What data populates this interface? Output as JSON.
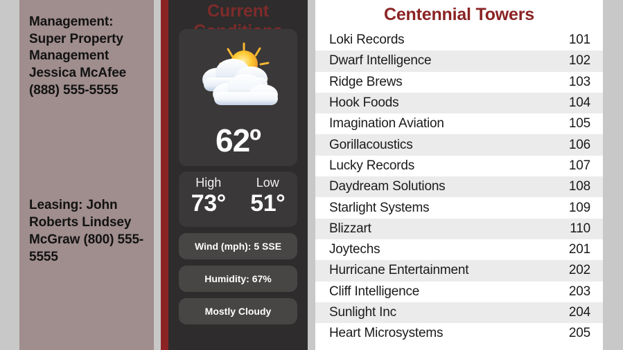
{
  "background_color": "#c8c8c8",
  "contact_panel": {
    "background_color": "#a08d8d",
    "management": "Management: Super Property Management Jessica McAfee (888) 555-5555",
    "leasing": "Leasing: John Roberts Lindsey McGraw (800) 555-5555"
  },
  "weather_panel": {
    "background_color": "#2e2c2c",
    "accent_bar_color": "#8b2324",
    "title": "Current Conditions",
    "title_color": "#7e2b2b",
    "icon": "partly-cloudy-sun-icon",
    "current_temp": "62º",
    "high_label": "High",
    "high_value": "73°",
    "low_label": "Low",
    "low_value": "51°",
    "wind": "Wind (mph): 5 SSE",
    "humidity": "Humidity: 67%",
    "condition": "Mostly Cloudy"
  },
  "directory_panel": {
    "title": "Centennial Towers",
    "title_color": "#8b2324",
    "rows": [
      {
        "name": "Loki Records",
        "suite": "101"
      },
      {
        "name": "Dwarf Intelligence",
        "suite": "102"
      },
      {
        "name": "Ridge Brews",
        "suite": "103"
      },
      {
        "name": "Hook Foods",
        "suite": "104"
      },
      {
        "name": "Imagination Aviation",
        "suite": "105"
      },
      {
        "name": "Gorillacoustics",
        "suite": "106"
      },
      {
        "name": "Lucky Records",
        "suite": "107"
      },
      {
        "name": "Daydream Solutions",
        "suite": "108"
      },
      {
        "name": "Starlight Systems",
        "suite": "109"
      },
      {
        "name": "Blizzart",
        "suite": "110"
      },
      {
        "name": "Joytechs",
        "suite": "201"
      },
      {
        "name": "Hurricane Entertainment",
        "suite": "202"
      },
      {
        "name": "Cliff Intelligence",
        "suite": "203"
      },
      {
        "name": "Sunlight Inc",
        "suite": "204"
      },
      {
        "name": "Heart Microsystems",
        "suite": "205"
      }
    ]
  }
}
